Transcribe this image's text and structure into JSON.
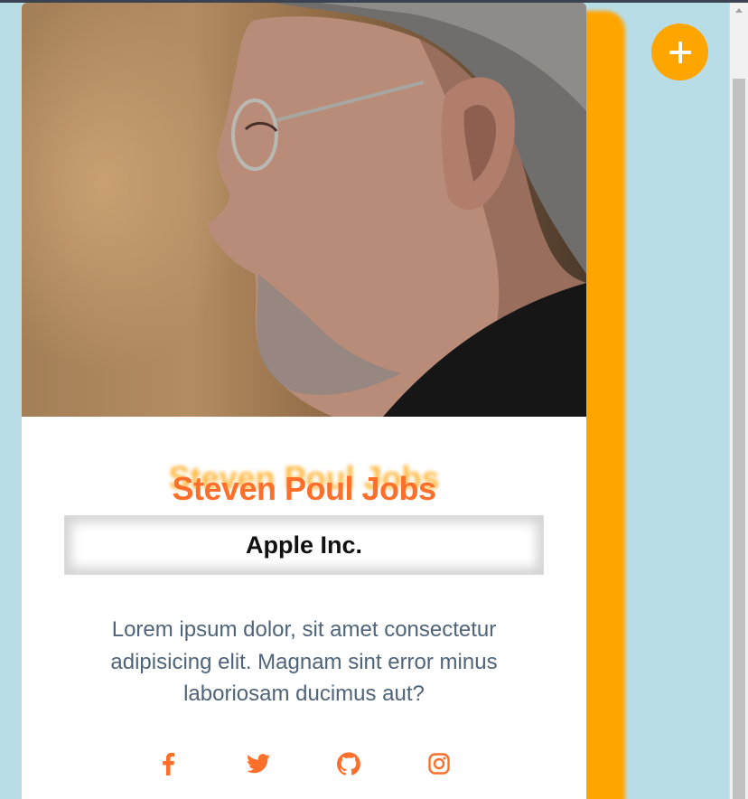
{
  "profile": {
    "name": "Steven Poul Jobs",
    "company": "Apple Inc.",
    "description": "Lorem ipsum dolor, sit amet consectetur adipisicing elit. Magnam sint error minus laboriosam ducimus aut?",
    "photo_icon": "profile-photo"
  },
  "socials": [
    {
      "name": "facebook",
      "icon": "facebook-icon"
    },
    {
      "name": "twitter",
      "icon": "twitter-icon"
    },
    {
      "name": "github",
      "icon": "github-icon"
    },
    {
      "name": "instagram",
      "icon": "instagram-icon"
    }
  ],
  "fab": {
    "icon": "plus-icon"
  },
  "colors": {
    "background": "#b9dde6",
    "accent": "#ffa500",
    "name": "#ff6f2c",
    "text": "#4f6479",
    "social": "#ff6f2c"
  }
}
